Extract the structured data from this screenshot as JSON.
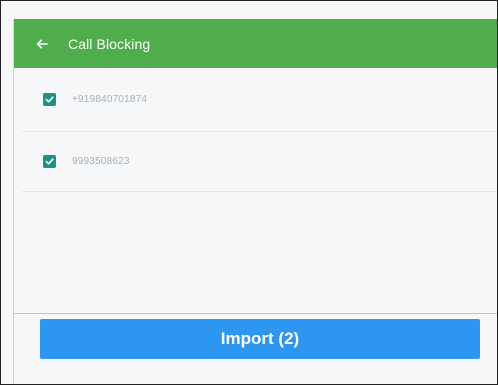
{
  "colors": {
    "appbar": "#4fad4c",
    "checkbox": "#1c9383",
    "import_button": "#2d96f1",
    "background": "#f6f7f8"
  },
  "appbar": {
    "back_icon": "arrow-left-icon",
    "title": "Call Blocking"
  },
  "contacts": [
    {
      "checked": true,
      "number": "+919840701874"
    },
    {
      "checked": true,
      "number": "9993508623"
    }
  ],
  "footer": {
    "import_label": "Import (2)"
  }
}
